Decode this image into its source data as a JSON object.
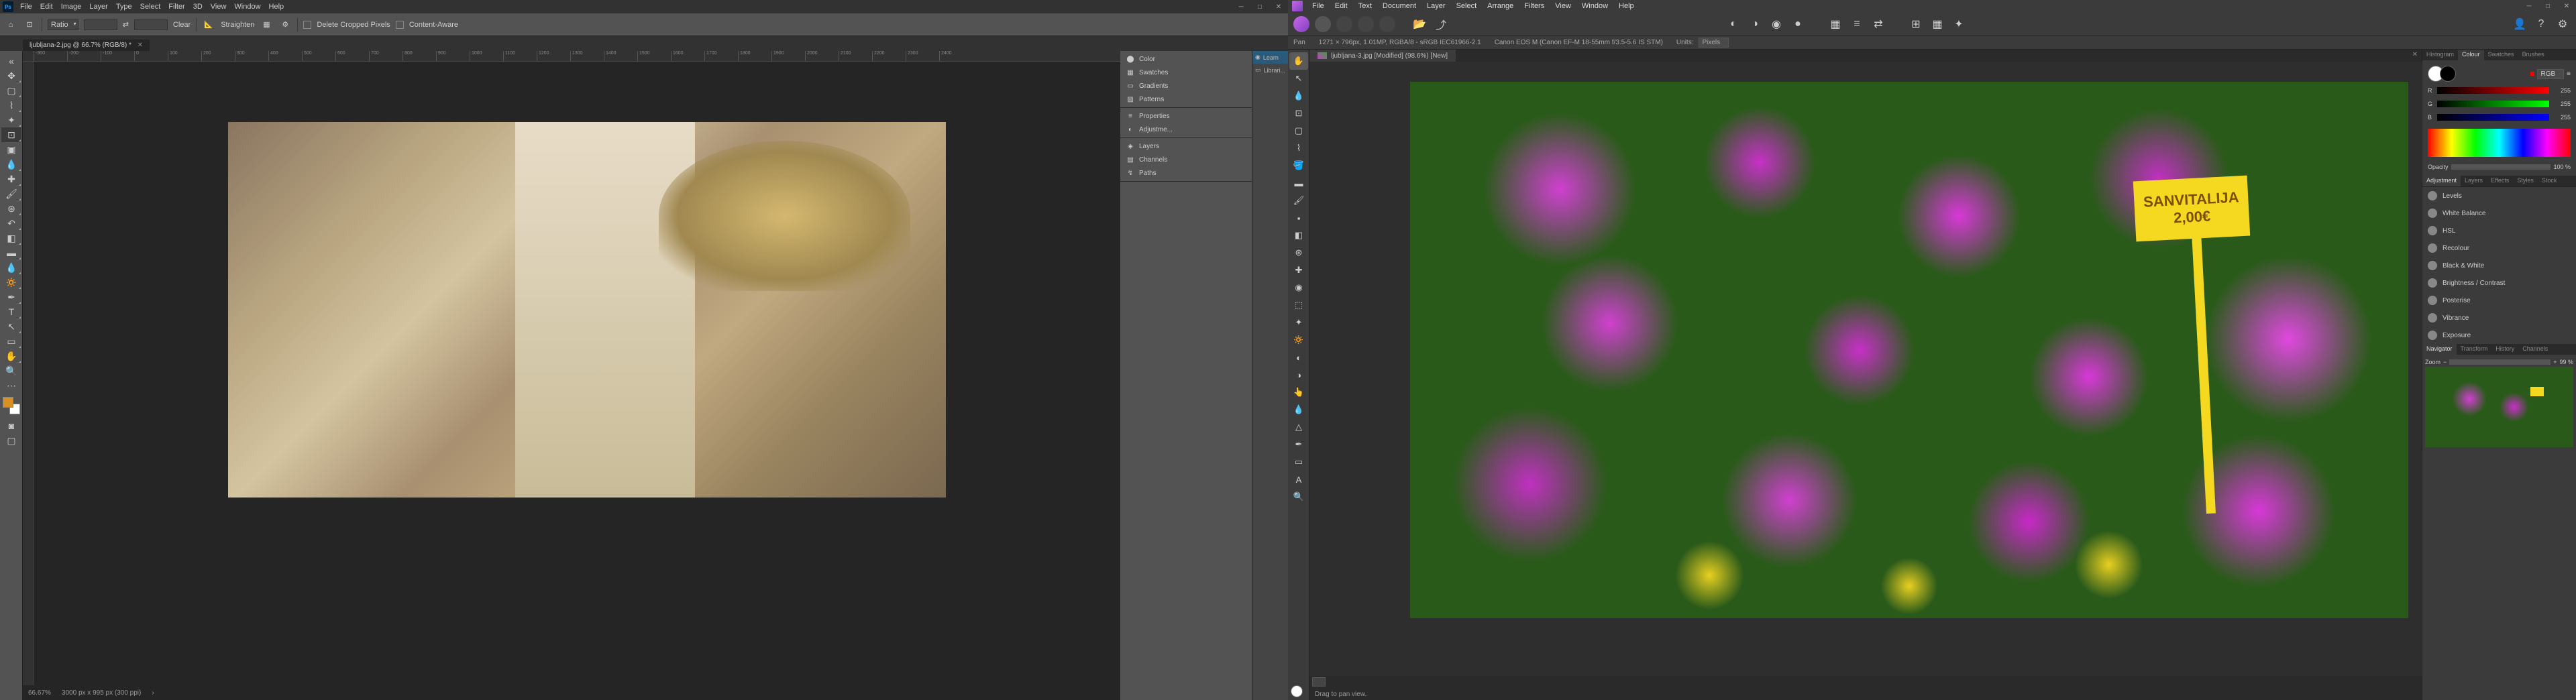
{
  "photoshop": {
    "menubar": [
      "File",
      "Edit",
      "Image",
      "Layer",
      "Type",
      "Select",
      "Filter",
      "3D",
      "View",
      "Window",
      "Help"
    ],
    "options": {
      "ratio_label": "Ratio",
      "ratio_w": "",
      "ratio_h": "",
      "clear": "Clear",
      "straighten": "Straighten",
      "delete_cropped": "Delete Cropped Pixels",
      "content_aware": "Content-Aware"
    },
    "tab": {
      "name": "ljubljana-2.jpg @ 66.7% (RGB/8) *"
    },
    "tools": [
      "move",
      "marquee",
      "lasso",
      "wand",
      "crop",
      "frame",
      "eyedropper",
      "heal",
      "brush",
      "stamp",
      "history",
      "eraser",
      "gradient",
      "blur",
      "dodge",
      "pen",
      "type",
      "path",
      "rect",
      "hand",
      "zoom"
    ],
    "ruler_ticks": [
      "-300",
      "-200",
      "-100",
      "0",
      "100",
      "200",
      "300",
      "400",
      "500",
      "600",
      "700",
      "800",
      "900",
      "1000",
      "1100",
      "1200",
      "1300",
      "1400",
      "1500",
      "1600",
      "1700",
      "1800",
      "1900",
      "2000",
      "2100",
      "2200",
      "2300",
      "2400"
    ],
    "panels": {
      "left": [
        {
          "icon": "⬤",
          "label": "Color"
        },
        {
          "icon": "▦",
          "label": "Swatches"
        },
        {
          "icon": "▭",
          "label": "Gradients"
        },
        {
          "icon": "▨",
          "label": "Patterns"
        },
        {
          "icon": "≡",
          "label": "Properties"
        },
        {
          "icon": "◐",
          "label": "Adjustme..."
        },
        {
          "icon": "◈",
          "label": "Layers"
        },
        {
          "icon": "▤",
          "label": "Channels"
        },
        {
          "icon": "↯",
          "label": "Paths"
        }
      ],
      "right": [
        {
          "icon": "◉",
          "label": "Learn",
          "sel": true
        },
        {
          "icon": "▭",
          "label": "Librari...",
          "sel": false
        }
      ]
    },
    "status": {
      "zoom": "66.67%",
      "dims": "3000 px x 995 px (300 ppi)"
    }
  },
  "affinity": {
    "menubar": [
      "File",
      "Edit",
      "Text",
      "Document",
      "Layer",
      "Select",
      "Arrange",
      "Filters",
      "View",
      "Window",
      "Help"
    ],
    "context": {
      "tool": "Pan",
      "info": "1271 × 796px, 1.01MP, RGBA/8 - sRGB IEC61966-2.1",
      "camera": "Canon EOS M (Canon EF-M 18-55mm f/3.5-5.6 IS STM)",
      "units_label": "Units:",
      "units": "Pixels"
    },
    "tab": {
      "name": "ljubljana-3.jpg [Modified] (98.6%) [New]"
    },
    "sign": {
      "line1": "SANVITALIJA",
      "line2": "2,00€"
    },
    "status": {
      "hint": "Drag to pan view."
    },
    "color": {
      "mode": "RGB",
      "r": "255",
      "g": "255",
      "b": "255",
      "opacity_label": "Opacity",
      "opacity": "100 %"
    },
    "panel_tabs_top": [
      "Histogram",
      "Colour",
      "Swatches",
      "Brushes"
    ],
    "adj_tabs": [
      "Adjustment",
      "Layers",
      "Effects",
      "Styles",
      "Stock"
    ],
    "adjustments": [
      {
        "label": "Levels",
        "icon": "◐"
      },
      {
        "label": "White Balance",
        "icon": "◑"
      },
      {
        "label": "HSL",
        "icon": "◉"
      },
      {
        "label": "Recolour",
        "icon": "●"
      },
      {
        "label": "Black & White",
        "icon": "◐"
      },
      {
        "label": "Brightness / Contrast",
        "icon": "◐"
      },
      {
        "label": "Posterise",
        "icon": "▦"
      },
      {
        "label": "Vibrance",
        "icon": "◉"
      },
      {
        "label": "Exposure",
        "icon": "◐"
      }
    ],
    "nav_tabs": [
      "Navigator",
      "Transform",
      "History",
      "Channels"
    ],
    "nav": {
      "zoom_label": "Zoom",
      "zoom_val": "99 %"
    }
  }
}
